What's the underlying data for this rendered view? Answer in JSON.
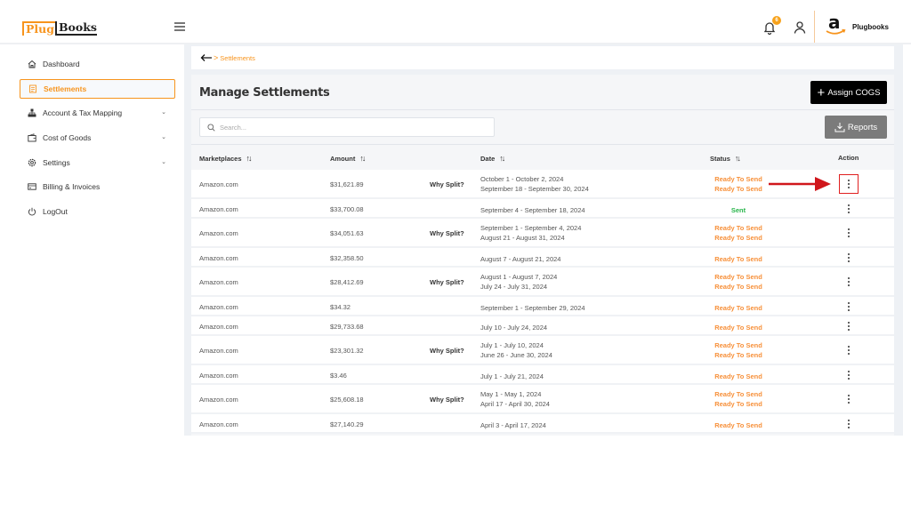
{
  "header": {
    "logo": {
      "part1": "Plug",
      "part2": "Books"
    },
    "notifications_count": "6",
    "account_name": "Plugbooks",
    "icons": [
      "menu-icon",
      "bell-icon",
      "user-icon",
      "amazon-logo"
    ]
  },
  "sidebar": {
    "items": [
      {
        "label": "Dashboard",
        "icon": "home-icon",
        "active": false,
        "expandable": false
      },
      {
        "label": "Settlements",
        "icon": "document-icon",
        "active": true,
        "expandable": false
      },
      {
        "label": "Account & Tax Mapping",
        "icon": "hierarchy-icon",
        "active": false,
        "expandable": true
      },
      {
        "label": "Cost of Goods",
        "icon": "wallet-icon",
        "active": false,
        "expandable": true
      },
      {
        "label": "Settings",
        "icon": "gear-icon",
        "active": false,
        "expandable": true
      },
      {
        "label": "Billing & Invoices",
        "icon": "card-icon",
        "active": false,
        "expandable": false
      },
      {
        "label": "LogOut",
        "icon": "power-icon",
        "active": false,
        "expandable": false
      }
    ]
  },
  "breadcrumb": {
    "separator": ">",
    "current": "Settlements"
  },
  "page": {
    "title": "Manage Settlements",
    "assign_cogs_label": "Assign COGS",
    "reports_label": "Reports",
    "search_placeholder": "Search...",
    "search_value": ""
  },
  "table": {
    "columns": [
      "Marketplaces",
      "Amount",
      "Date",
      "Status",
      "Action"
    ],
    "sort_glyph": "↑↓",
    "rows": [
      {
        "marketplace": "Amazon.com",
        "amount": "$31,621.89",
        "why_split": "Why Split?",
        "dates": [
          "October 1 - October 2, 2024",
          "September 18 - September 30, 2024"
        ],
        "statuses": [
          "Ready To Send",
          "Ready To Send"
        ],
        "highlighted": true
      },
      {
        "marketplace": "Amazon.com",
        "amount": "$33,700.08",
        "why_split": "",
        "dates": [
          "September 4 - September 18, 2024"
        ],
        "statuses": [
          "Sent"
        ]
      },
      {
        "marketplace": "Amazon.com",
        "amount": "$34,051.63",
        "why_split": "Why Split?",
        "dates": [
          "September 1 - September 4, 2024",
          "August 21 - August 31, 2024"
        ],
        "statuses": [
          "Ready To Send",
          "Ready To Send"
        ]
      },
      {
        "marketplace": "Amazon.com",
        "amount": "$32,358.50",
        "why_split": "",
        "dates": [
          "August 7 - August 21, 2024"
        ],
        "statuses": [
          "Ready To Send"
        ]
      },
      {
        "marketplace": "Amazon.com",
        "amount": "$28,412.69",
        "why_split": "Why Split?",
        "dates": [
          "August 1 - August 7, 2024",
          "July 24 - July 31, 2024"
        ],
        "statuses": [
          "Ready To Send",
          "Ready To Send"
        ]
      },
      {
        "marketplace": "Amazon.com",
        "amount": "$34.32",
        "why_split": "",
        "dates": [
          "September 1 - September 29, 2024"
        ],
        "statuses": [
          "Ready To Send"
        ]
      },
      {
        "marketplace": "Amazon.com",
        "amount": "$29,733.68",
        "why_split": "",
        "dates": [
          "July 10 - July 24, 2024"
        ],
        "statuses": [
          "Ready To Send"
        ]
      },
      {
        "marketplace": "Amazon.com",
        "amount": "$23,301.32",
        "why_split": "Why Split?",
        "dates": [
          "July 1 - July 10, 2024",
          "June 26 - June 30, 2024"
        ],
        "statuses": [
          "Ready To Send",
          "Ready To Send"
        ]
      },
      {
        "marketplace": "Amazon.com",
        "amount": "$3.46",
        "why_split": "",
        "dates": [
          "July 1 - July 21, 2024"
        ],
        "statuses": [
          "Ready To Send"
        ]
      },
      {
        "marketplace": "Amazon.com",
        "amount": "$25,608.18",
        "why_split": "Why Split?",
        "dates": [
          "May 1 - May 1, 2024",
          "April 17 - April 30, 2024"
        ],
        "statuses": [
          "Ready To Send",
          "Ready To Send"
        ]
      },
      {
        "marketplace": "Amazon.com",
        "amount": "$27,140.29",
        "why_split": "",
        "dates": [
          "April 3 - April 17, 2024"
        ],
        "statuses": [
          "Ready To Send"
        ]
      }
    ]
  },
  "colors": {
    "brand_orange": "#f7941d",
    "ready_status": "#f7903a",
    "sent_status": "#27b54a",
    "annotation_red": "#d0161b"
  }
}
